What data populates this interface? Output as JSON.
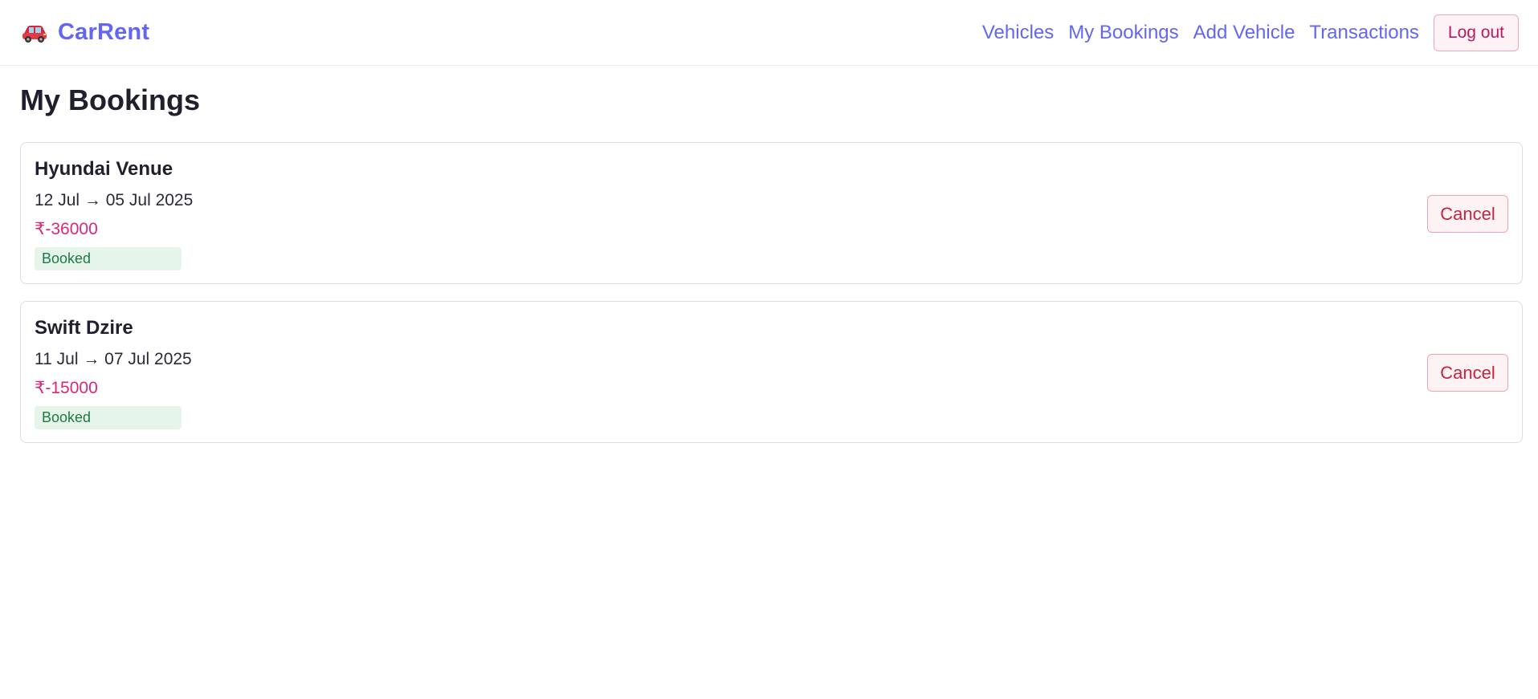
{
  "app": {
    "brand_name": "CarRent",
    "brand_icon": "car-icon",
    "accent_color": "#6366f1"
  },
  "nav": {
    "items": [
      {
        "label": "Vehicles"
      },
      {
        "label": "My Bookings"
      },
      {
        "label": "Add Vehicle"
      },
      {
        "label": "Transactions"
      }
    ],
    "logout_label": "Log out"
  },
  "page": {
    "title": "My Bookings"
  },
  "bookings": [
    {
      "vehicle": "Hyundai Venue",
      "dates": "12 Jul → 05 Jul 2025",
      "price": "₹-36000",
      "status": "Booked",
      "cancel_label": "Cancel"
    },
    {
      "vehicle": "Swift Dzire",
      "dates": "11 Jul → 07 Jul 2025",
      "price": "₹-15000",
      "status": "Booked",
      "cancel_label": "Cancel"
    }
  ],
  "colors": {
    "price": "#db2777",
    "status_bg": "#e6f5ea",
    "status_text": "#1e7a44",
    "cancel_text": "#c0263e"
  }
}
